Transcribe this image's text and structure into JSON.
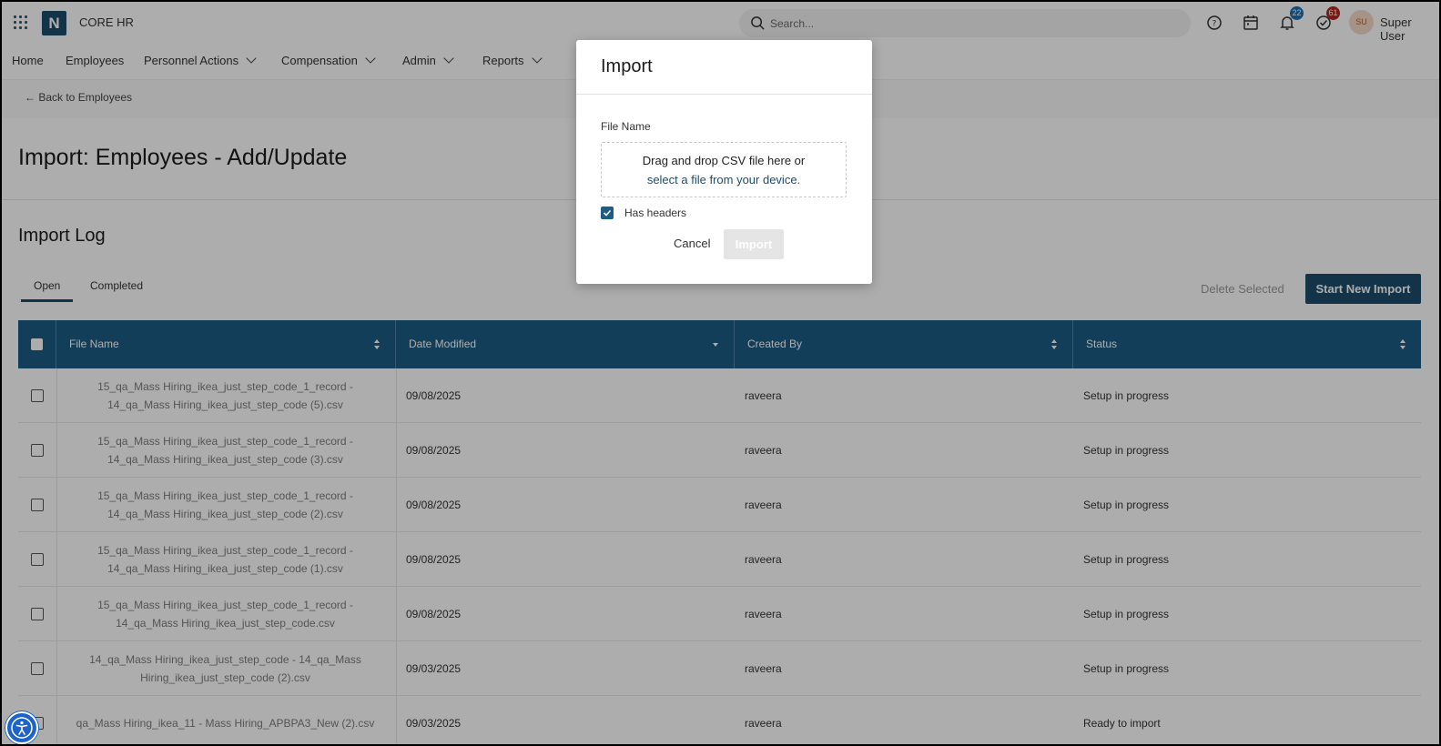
{
  "header": {
    "app_name": "CORE HR",
    "logo_letter": "N",
    "search_placeholder": "Search...",
    "notifications_count": "22",
    "tasks_count": "61",
    "avatar_initials": "SU",
    "user_name": "Super User"
  },
  "nav": {
    "items": [
      "Home",
      "Employees",
      "Personnel Actions",
      "Compensation",
      "Admin",
      "Reports"
    ]
  },
  "back_link": "← Back to Employees",
  "page_title": "Import: Employees - Add/Update",
  "import_log": {
    "title": "Import Log",
    "tabs": [
      "Open",
      "Completed"
    ],
    "delete_label": "Delete Selected",
    "start_label": "Start New Import",
    "columns": [
      "File Name",
      "Date Modified",
      "Created By",
      "Status"
    ],
    "rows": [
      {
        "file": "15_qa_Mass Hiring_ikea_just_step_code_1_record - 14_qa_Mass Hiring_ikea_just_step_code (5).csv",
        "date": "09/08/2025",
        "by": "raveera",
        "status": "Setup in progress"
      },
      {
        "file": "15_qa_Mass Hiring_ikea_just_step_code_1_record - 14_qa_Mass Hiring_ikea_just_step_code (3).csv",
        "date": "09/08/2025",
        "by": "raveera",
        "status": "Setup in progress"
      },
      {
        "file": "15_qa_Mass Hiring_ikea_just_step_code_1_record - 14_qa_Mass Hiring_ikea_just_step_code (2).csv",
        "date": "09/08/2025",
        "by": "raveera",
        "status": "Setup in progress"
      },
      {
        "file": "15_qa_Mass Hiring_ikea_just_step_code_1_record - 14_qa_Mass Hiring_ikea_just_step_code (1).csv",
        "date": "09/08/2025",
        "by": "raveera",
        "status": "Setup in progress"
      },
      {
        "file": "15_qa_Mass Hiring_ikea_just_step_code_1_record - 14_qa_Mass Hiring_ikea_just_step_code.csv",
        "date": "09/08/2025",
        "by": "raveera",
        "status": "Setup in progress"
      },
      {
        "file": "14_qa_Mass Hiring_ikea_just_step_code - 14_qa_Mass Hiring_ikea_just_step_code (2).csv",
        "date": "09/03/2025",
        "by": "raveera",
        "status": "Setup in progress"
      },
      {
        "file": "qa_Mass Hiring_ikea_11 - Mass Hiring_APBPA3_New (2).csv",
        "date": "09/03/2025",
        "by": "raveera",
        "status": "Ready to import"
      }
    ]
  },
  "modal": {
    "title": "Import",
    "field_label": "File Name",
    "drop_line1": "Drag and drop CSV file here or",
    "drop_link": "select a file from your device.",
    "checkbox_label": "Has headers",
    "checkbox_checked": true,
    "cancel_label": "Cancel",
    "import_label": "Import"
  },
  "colors": {
    "primary": "#1d4d6b",
    "table_header": "#1d5c85",
    "badge_blue": "#1e6eb0",
    "badge_red": "#b3261e"
  }
}
